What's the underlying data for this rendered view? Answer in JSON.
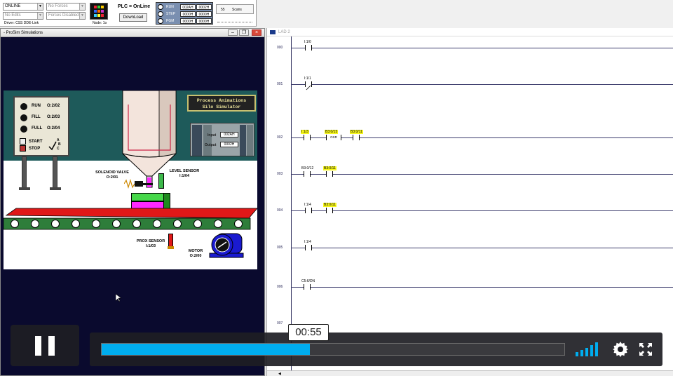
{
  "toolbar": {
    "mode_select": "ONLINE",
    "forces_select": "No Forces",
    "edits_select": "No Edits",
    "forces_disabled_select": "Forces Disabled",
    "driver_label": "Driver: CSS DDE-Link",
    "node_label": "Node: 1o",
    "plc_status": "PLC = OnLine",
    "download_button": "DownLoad",
    "reg_labels": [
      "RUN",
      "STEP",
      "PGM"
    ],
    "reg_values": [
      [
        "002AH",
        "0002H"
      ],
      [
        "0000H",
        "0000H"
      ],
      [
        "0000H",
        "0000H"
      ]
    ],
    "scan_count": "55",
    "scans_label": "Scans"
  },
  "sim_window": {
    "title": "- ProSim Simulations",
    "panel": {
      "run": "RUN",
      "run_addr": "O:2/02",
      "fill": "FILL",
      "fill_addr": "O:2/03",
      "full": "FULL",
      "full_addr": "O:2/04",
      "start": "START",
      "stop": "STOP",
      "abc": [
        "A",
        "B",
        "C"
      ]
    },
    "banner_line1": "Process Animations",
    "banner_line2": "Silo Simulator",
    "input_label": "Input",
    "input_value": "002AH",
    "output_label": "Output",
    "output_value": "0002H",
    "solenoid_label": "SOLENOID VALVE",
    "solenoid_addr": "O:2/01",
    "level_label": "LEVEL SENSOR",
    "level_addr": "I:1/04",
    "prox_label": "PROX SENSOR",
    "prox_addr": "I:1/03",
    "motor_label": "MOTOR",
    "motor_addr": "O:2/00"
  },
  "ladder_window": {
    "title": "LAD 2",
    "rungs": [
      {
        "num": "000",
        "addrs": [
          "I:1/0"
        ]
      },
      {
        "num": "001",
        "addrs": [
          "I:1/1"
        ]
      },
      {
        "num": "002",
        "addrs": [
          "I:1/3",
          "B3:0/15",
          "B3:0/11"
        ],
        "osr": "OSR"
      },
      {
        "num": "003",
        "addrs": [
          "B3:0/12",
          "B3:0/11"
        ]
      },
      {
        "num": "004",
        "addrs": [
          "I:1/4",
          "B3:0/11"
        ]
      },
      {
        "num": "005",
        "addrs": [
          "I:1/4"
        ]
      },
      {
        "num": "006",
        "addrs": [
          "C5:6/DN"
        ]
      },
      {
        "num": "007",
        "addrs": []
      }
    ]
  },
  "player": {
    "time_tooltip": "00:55",
    "progress": 0.45,
    "accent": "#00adef"
  }
}
